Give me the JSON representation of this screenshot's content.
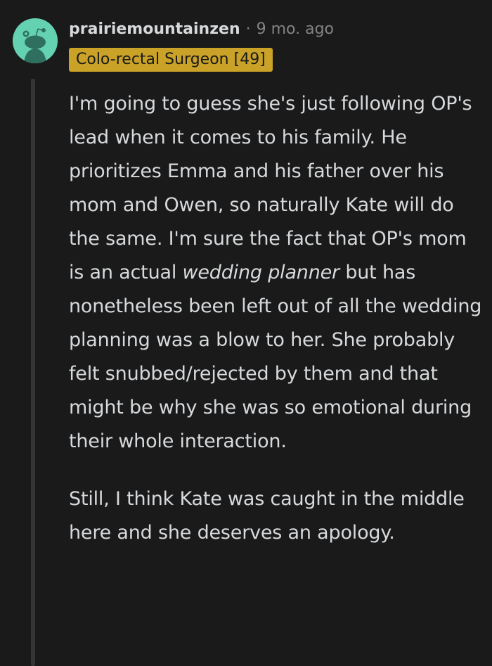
{
  "comment": {
    "username": "prairiemountainzen",
    "separator": "·",
    "timestamp": "9 mo. ago",
    "flair": "Colo-rectal Surgeon [49]",
    "avatar_icon": "snoo-avatar-icon",
    "colors": {
      "background": "#1a1a1b",
      "text": "#d7dadc",
      "muted": "#818384",
      "flair_bg": "#c9a227",
      "avatar_bg": "#64d2b0",
      "thread_line": "#343536"
    },
    "paragraph1": {
      "before_em": "I'm going to guess she's just following OP's lead when it comes to his family. He prioritizes Emma and his father over his mom and Owen, so naturally Kate will do the same. I'm sure the fact that OP's mom is an actual ",
      "em": "wedding planner",
      "after_em": " but has nonetheless been left out of all the wedding planning was a blow to her. She probably felt snubbed/rejected by them and that might be why she was so emotional during their whole interaction."
    },
    "paragraph2": "Still, I think Kate was caught in the middle here and she deserves an apology."
  }
}
